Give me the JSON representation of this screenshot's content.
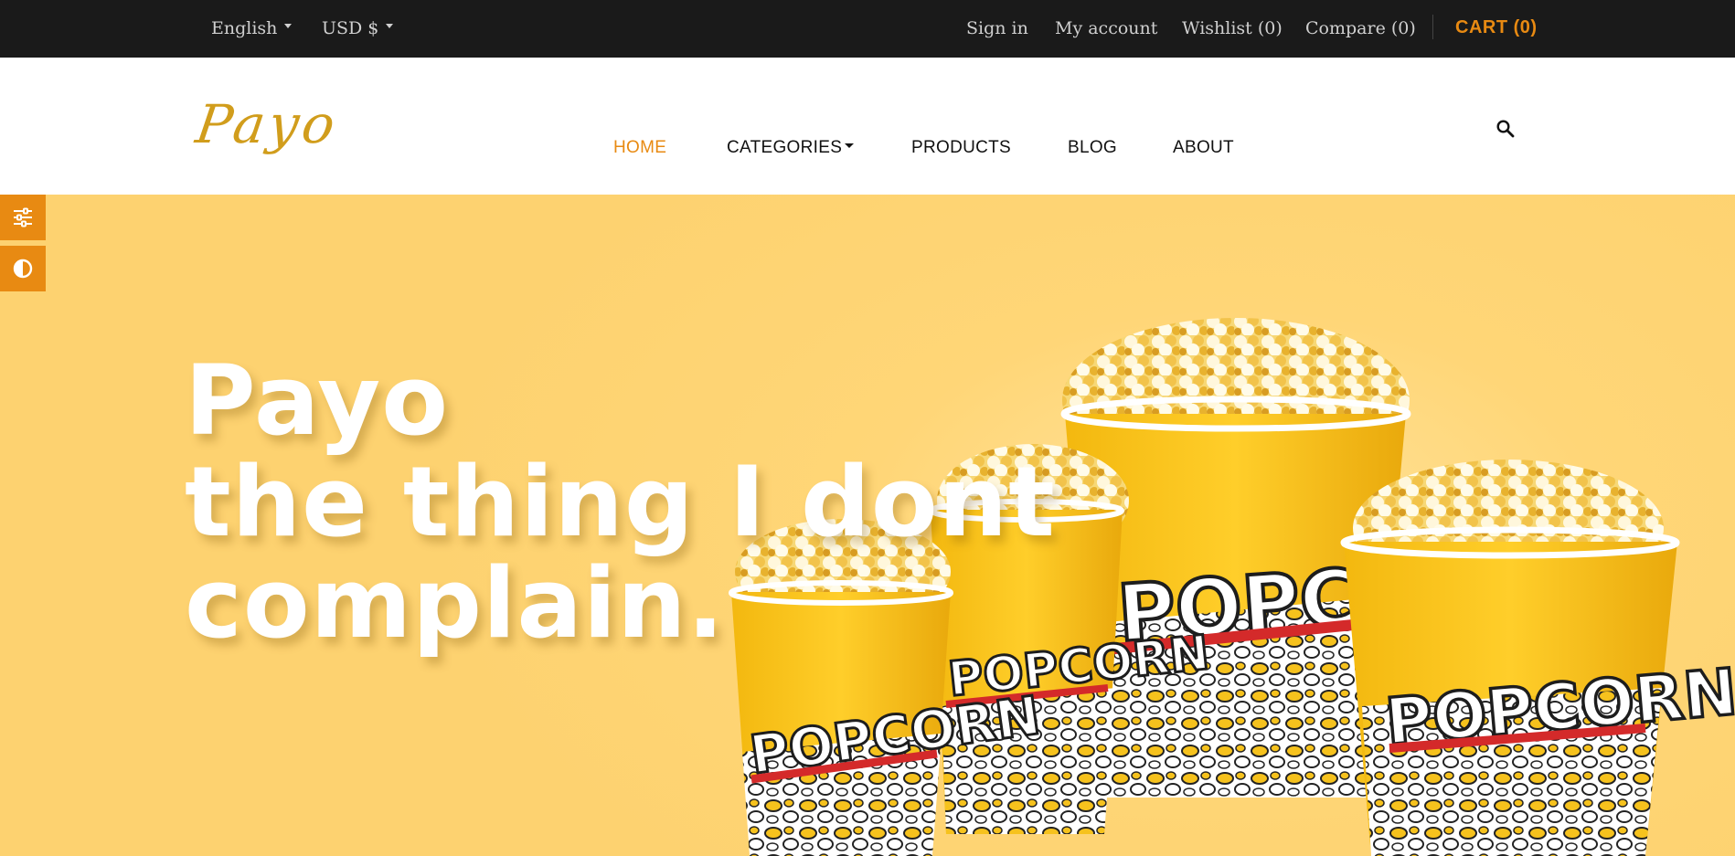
{
  "topbar": {
    "language": "English",
    "currency": "USD $",
    "sign_in": "Sign in",
    "my_account": "My account",
    "wishlist": "Wishlist (0)",
    "compare": "Compare (0)",
    "cart": "CART (0)"
  },
  "header": {
    "logo": "Payo",
    "nav": {
      "home": "HOME",
      "categories": "CATEGORIES",
      "products": "PRODUCTS",
      "blog": "BLOG",
      "about": "ABOUT"
    }
  },
  "hero": {
    "line1": "Payo",
    "line2": "the thing I dont",
    "line3": "complain.",
    "image_label": "POPCORN"
  },
  "side_tools": [
    "sliders-icon",
    "contrast-icon"
  ],
  "colors": {
    "accent": "#e88a12",
    "topbar_bg": "#1a1a1a",
    "hero_bg": "#fdd270",
    "logo": "#d19d1c"
  }
}
